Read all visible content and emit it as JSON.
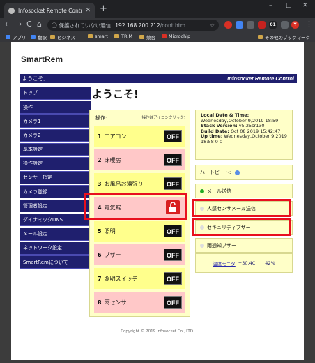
{
  "browser": {
    "tab_title": "Infosocket Remote Control",
    "tab_close": "✕",
    "new_tab": "+",
    "win_min": "–",
    "win_max": "□",
    "win_close": "✕",
    "nav_back": "←",
    "nav_forward": "→",
    "nav_reload": "C",
    "nav_home": "⌂",
    "security_label": "保護されていない通信",
    "url_host": "192.168.200.212",
    "url_path": "/cont.htm",
    "ext_badge": "01",
    "profile_initial": "Y",
    "menu": "⋮",
    "bookmarks": [
      "アプリ",
      "翻訳",
      "ビジネス",
      "smart",
      "TRIM",
      "競合",
      "Microchip"
    ],
    "other_bookmarks": "その他のブックマーク"
  },
  "page": {
    "brand": "SmartRem",
    "welcome_bar": "ようこそ,",
    "product_name": "Infosocket Remote Control",
    "title": "ようこそ!",
    "menu": [
      "トップ",
      "操作",
      "カメラ1",
      "カメラ2",
      "基本設定",
      "操作設定",
      "センサー指定",
      "カメラ登録",
      "管理者設定",
      "ダイナミックDNS",
      "メール設定",
      "ネットワーク設定",
      "SmartRemについて"
    ],
    "controls_label": "操作:",
    "controls_hint": "(操作はアイコンクリック)",
    "controls": [
      {
        "num": "1",
        "name": "エアコン",
        "state": "OFF",
        "color": "#ffff8c"
      },
      {
        "num": "2",
        "name": "床暖房",
        "state": "OFF",
        "color": "#ffc8c8"
      },
      {
        "num": "3",
        "name": "お風呂お湯張り",
        "state": "OFF",
        "color": "#ffff8c"
      },
      {
        "num": "4",
        "name": "電気錠",
        "state": "",
        "color": "#ffc8c8"
      },
      {
        "num": "5",
        "name": "照明",
        "state": "OFF",
        "color": "#ffff8c"
      },
      {
        "num": "6",
        "name": "ブザー",
        "state": "OFF",
        "color": "#ffc8c8"
      },
      {
        "num": "7",
        "name": "照明スイッチ",
        "state": "OFF",
        "color": "#ffff8c"
      },
      {
        "num": "8",
        "name": "雨センサ",
        "state": "OFF",
        "color": "#ffc8c8"
      }
    ],
    "info": {
      "local_date_label": "Local Date & Time:",
      "local_date": "Wednesday,October 9,2019 18:59",
      "stack_label": "Stack Version:",
      "stack_version": "v5.25sr130",
      "build_label": "Build Date:",
      "build_date": "Oct 08 2019 15:42:47",
      "uptime_label": "Up time:",
      "uptime": "Wednesday,October 9,2019 18:58 0 0"
    },
    "heartbeat_label": "ハートビート:",
    "status_rows": [
      {
        "label": "メール送信",
        "dot_color": "#22aa22"
      },
      {
        "label": "人感センサメール送信",
        "dot_color": "#dddddd"
      },
      {
        "label": "セキュリティブザー",
        "dot_color": "#dddddd"
      },
      {
        "label": "雨通知ブザー",
        "dot_color": "#dddddd"
      }
    ],
    "temp_link": "温度モニタ",
    "temp_value": "+30.4C",
    "humidity_value": "42%",
    "footer": "Copyright © 2019 Infosocket Co., LTD."
  },
  "colors": {
    "nav_bg": "#1f1f6e",
    "highlight": "#e8101e",
    "panel_bg": "#ffffc8"
  }
}
